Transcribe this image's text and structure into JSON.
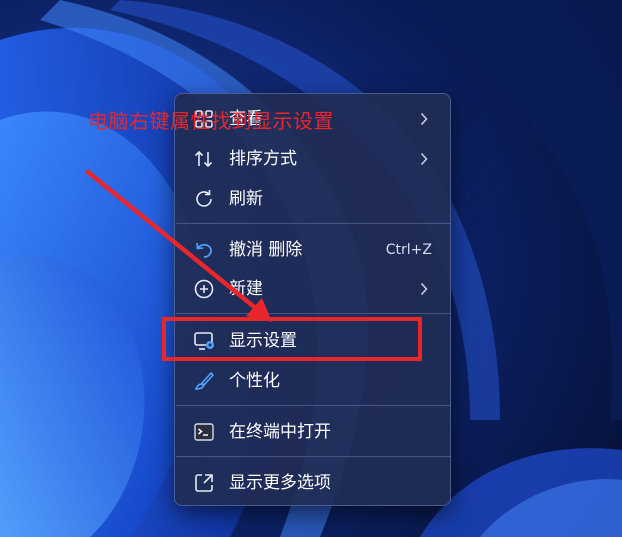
{
  "menu": {
    "items": [
      {
        "name": "view",
        "label": "查看",
        "icon": "grid-icon",
        "has_submenu": true
      },
      {
        "name": "sort",
        "label": "排序方式",
        "icon": "sort-icon",
        "has_submenu": true
      },
      {
        "name": "refresh",
        "label": "刷新",
        "icon": "refresh-icon",
        "has_submenu": false
      },
      {
        "name": "undo-delete",
        "label": "撤消 删除",
        "shortcut": "Ctrl+Z",
        "icon": "undo-icon",
        "has_submenu": false
      },
      {
        "name": "new",
        "label": "新建",
        "icon": "plus-circle-icon",
        "has_submenu": true
      },
      {
        "name": "display-settings",
        "label": "显示设置",
        "icon": "display-settings-icon",
        "has_submenu": false
      },
      {
        "name": "personalize",
        "label": "个性化",
        "icon": "brush-icon",
        "has_submenu": false
      },
      {
        "name": "open-terminal",
        "label": "在终端中打开",
        "icon": "terminal-icon",
        "has_submenu": false
      },
      {
        "name": "show-more-options",
        "label": "显示更多选项",
        "icon": "open-external-icon",
        "has_submenu": false
      }
    ]
  },
  "annotation": {
    "text": "电脑右键属性找到显示设置",
    "color": "#e8262c"
  },
  "colors": {
    "menu_background": "#202c54",
    "menu_text": "#ffffff",
    "icon_accent": "#4ea3ff",
    "wallpaper_dark": "#0a1a4a",
    "wallpaper_bloom": "#2a6cf0"
  }
}
